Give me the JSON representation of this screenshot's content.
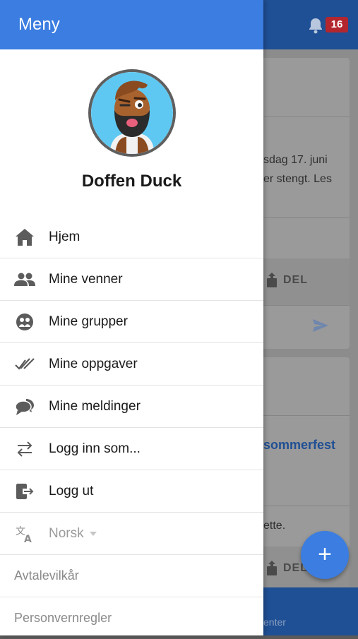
{
  "background": {
    "notification_count": "16",
    "card1_lines": [
      "sdag 17. juni",
      "er stengt. Les"
    ],
    "share_label": "DEL",
    "card2_link": "sommerfest",
    "card2_text": "ette.",
    "share_label_2": "DEL",
    "footer_text": "enter",
    "fab_label": "+"
  },
  "drawer": {
    "title": "Meny",
    "user_name": "Doffen Duck",
    "items": [
      {
        "label": "Hjem",
        "icon": "home-icon"
      },
      {
        "label": "Mine venner",
        "icon": "friends-icon"
      },
      {
        "label": "Mine grupper",
        "icon": "groups-icon"
      },
      {
        "label": "Mine oppgaver",
        "icon": "tasks-check-icon"
      },
      {
        "label": "Mine meldinger",
        "icon": "messages-icon"
      },
      {
        "label": "Logg inn som...",
        "icon": "switch-arrows-icon"
      },
      {
        "label": "Logg ut",
        "icon": "logout-icon"
      }
    ],
    "language": {
      "label": "Norsk",
      "icon": "translate-icon"
    },
    "links": [
      "Avtalevilkår",
      "Personvernregler"
    ]
  },
  "colors": {
    "primary": "#3b7de0",
    "dark_primary": "#1f4f94",
    "badge": "#b3262e"
  }
}
